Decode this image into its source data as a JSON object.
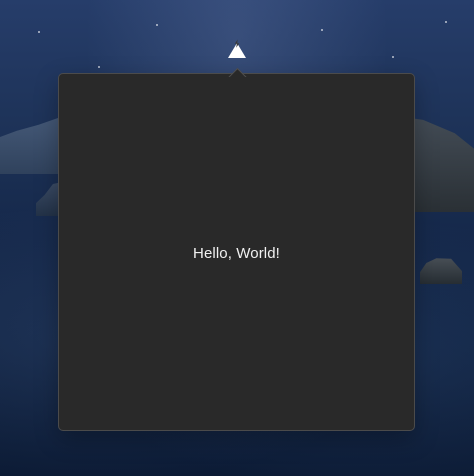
{
  "status_item": {
    "icon": "lightning-icon",
    "accent_color": "#ffffff"
  },
  "popover": {
    "message": "Hello, World!"
  }
}
